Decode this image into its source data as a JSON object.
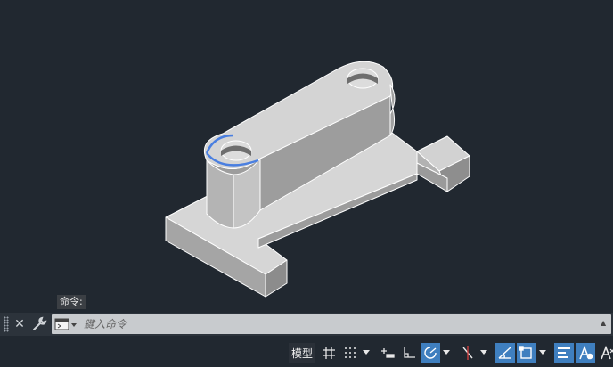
{
  "command_line": {
    "history_text": "命令:",
    "input_placeholder": "鍵入命令",
    "close_icon": "close-icon",
    "customize_icon": "wrench-icon",
    "prompt_icon": "command-prompt-icon",
    "scroll_icon": "scroll-up-icon"
  },
  "status_bar": {
    "model_label": "模型",
    "tools": [
      "grid-icon",
      "snap-icon",
      "dropdown-icon",
      "infer-constraints-icon",
      "ortho-icon",
      "polar-tracking-icon",
      "dropdown-icon",
      "isometric-draft-icon",
      "dropdown-icon",
      "object-snap-tracking-icon",
      "object-snap-icon",
      "dropdown-icon",
      "lineweight-icon",
      "annotation-scale-icon",
      "annotation-visibility-icon"
    ]
  },
  "viewport": {
    "background": "#212830",
    "selection_highlight": "#4a7fe0",
    "model_object": "3d-bracket-with-bosses"
  }
}
